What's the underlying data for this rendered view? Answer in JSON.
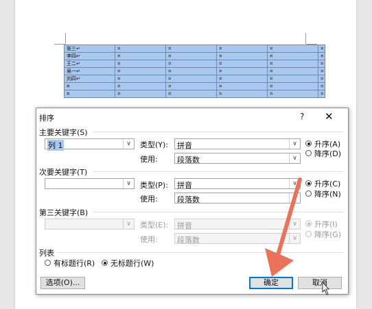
{
  "document": {
    "table_rows": [
      [
        "张三\u0002",
        "¤",
        "¤",
        "¤",
        "¤"
      ],
      [
        "李四\u0002",
        "¤",
        "¤",
        "¤",
        "¤"
      ],
      [
        "王二\u0002",
        "¤",
        "¤",
        "¤",
        "¤"
      ],
      [
        "吴一\u0002",
        "¤",
        "¤",
        "¤",
        "¤"
      ],
      [
        "刘四\u0002",
        "¤",
        "¤",
        "¤",
        "¤"
      ],
      [
        "¤",
        "¤",
        "¤",
        "¤",
        "¤"
      ],
      [
        "¤",
        "¤",
        "¤",
        "¤",
        "¤"
      ]
    ],
    "row_end_mark": "¤"
  },
  "dialog": {
    "title": "排序",
    "help_label": "?",
    "close_label": "✕",
    "primary_key": {
      "label": "主要关键字(S)",
      "field": "列 1",
      "type_label": "类型(Y):",
      "type_value": "拼音",
      "use_label": "使用:",
      "use_value": "段落数",
      "asc_label": "升序(A)",
      "desc_label": "降序(D)",
      "order": "asc"
    },
    "secondary_key": {
      "label": "次要关键字(T)",
      "field": "",
      "type_label": "类型(P):",
      "type_value": "拼音",
      "use_label": "使用:",
      "use_value": "段落数",
      "asc_label": "升序(C)",
      "desc_label": "降序(N)",
      "order": "asc"
    },
    "third_key": {
      "label": "第三关键字(B)",
      "field": "",
      "type_label": "类型(E):",
      "type_value": "拼音",
      "use_label": "使用:",
      "use_value": "段落数",
      "asc_label": "升序(I)",
      "desc_label": "降序(G)",
      "order": "asc",
      "disabled": true
    },
    "list": {
      "label": "列表",
      "header_row_label": "有标题行(R)",
      "no_header_row_label": "无标题行(W)",
      "selected": "no_header"
    },
    "options_button": "选项(O)...",
    "ok_button": "确定",
    "cancel_button": "取消"
  },
  "colors": {
    "selection": "#a9c8ef",
    "annotation_arrow": "#e8735a",
    "focus_border": "#0078d7"
  }
}
